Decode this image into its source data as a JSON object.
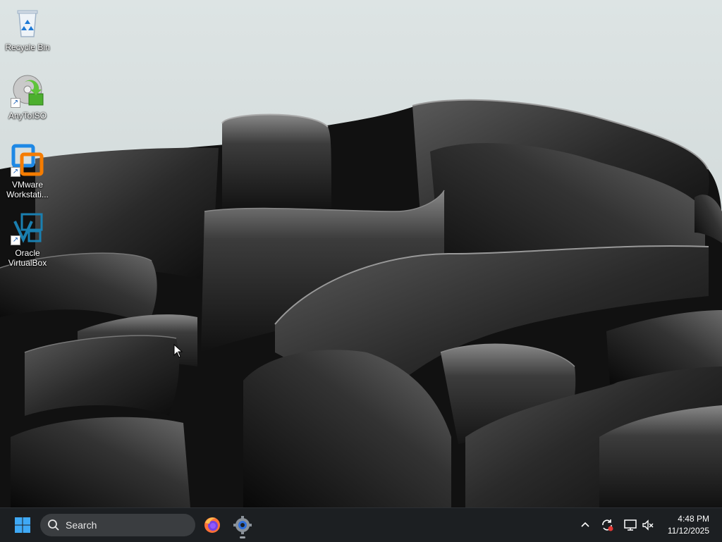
{
  "desktop": {
    "icons": [
      {
        "label": "Recycle Bin",
        "icon": "recycle-bin-icon"
      },
      {
        "label": "AnyToISO",
        "icon": "anytoiso-icon"
      },
      {
        "label": "VMware Workstati...",
        "icon": "vmware-icon"
      },
      {
        "label": "Oracle VirtualBox",
        "icon": "virtualbox-icon"
      }
    ]
  },
  "taskbar": {
    "search_placeholder": "Search",
    "apps": [
      {
        "name": "Firefox",
        "icon": "firefox-icon"
      },
      {
        "name": "Settings",
        "icon": "settings-gear-icon",
        "active": true
      }
    ],
    "tray": {
      "icons": [
        "chevron-up-icon",
        "sync-icon",
        "network-icon",
        "volume-muted-icon"
      ]
    },
    "clock": {
      "time": "4:48 PM",
      "date": "11/12/2025"
    }
  },
  "colors": {
    "taskbar_bg": "#1c1f22",
    "wallpaper_sky": "#d5dcdc",
    "wallpaper_ribbons": "#2a2a2a"
  }
}
